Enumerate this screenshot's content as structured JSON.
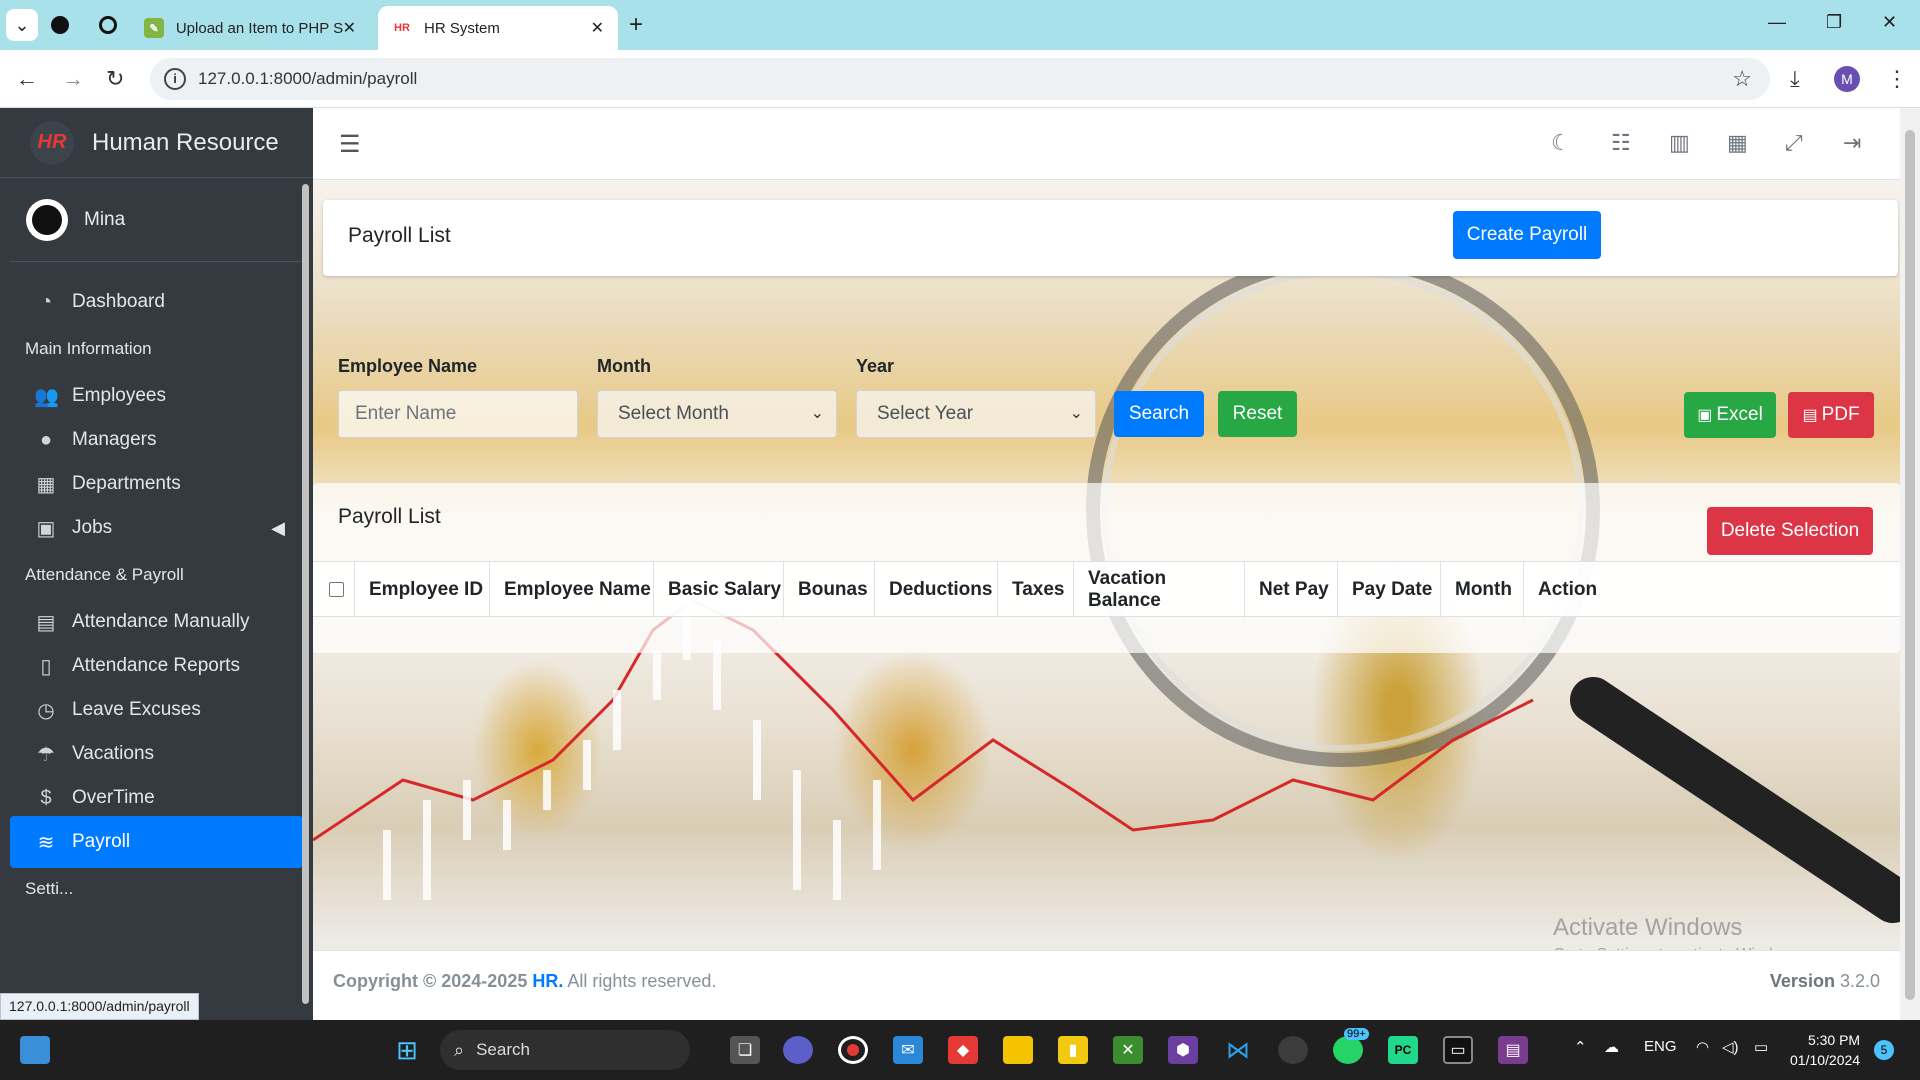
{
  "browser": {
    "tabs": [
      {
        "title": "Upload an Item to PHP Scripts | ",
        "active": false
      },
      {
        "title": "HR System",
        "active": true
      }
    ],
    "url": "127.0.0.1:8000/admin/payroll",
    "profile_initial": "M"
  },
  "sidebar": {
    "brand": "Human Resource",
    "logo_text": "HR",
    "user": "Mina",
    "items": [
      {
        "type": "item",
        "label": "Dashboard",
        "icon": "tachometer-icon"
      },
      {
        "type": "header",
        "label": "Main Information"
      },
      {
        "type": "item",
        "label": "Employees",
        "icon": "users-icon"
      },
      {
        "type": "item",
        "label": "Managers",
        "icon": "user-icon"
      },
      {
        "type": "item",
        "label": "Departments",
        "icon": "building-icon"
      },
      {
        "type": "item",
        "label": "Jobs",
        "icon": "briefcase-icon"
      },
      {
        "type": "header",
        "label": "Attendance & Payroll"
      },
      {
        "type": "item",
        "label": "Attendance Manually",
        "icon": "calendar-icon"
      },
      {
        "type": "item",
        "label": "Attendance Reports",
        "icon": "file-icon"
      },
      {
        "type": "item",
        "label": "Leave Excuses",
        "icon": "clock-icon"
      },
      {
        "type": "item",
        "label": "Vacations",
        "icon": "umbrella-beach-icon"
      },
      {
        "type": "item",
        "label": "OverTime",
        "icon": "dollar-icon"
      },
      {
        "type": "item",
        "label": "Payroll",
        "icon": "coins-icon",
        "active": true
      },
      {
        "type": "header",
        "label": "Setti..."
      }
    ],
    "status_url": "127.0.0.1:8000/admin/payroll"
  },
  "page": {
    "title": "Payroll List",
    "create_button": "Create Payroll",
    "filters": {
      "employee_name_label": "Employee Name",
      "employee_name_placeholder": "Enter Name",
      "month_label": "Month",
      "month_value": "Select Month",
      "year_label": "Year",
      "year_value": "Select Year",
      "search_button": "Search",
      "reset_button": "Reset",
      "excel_button": "Excel",
      "pdf_button": "PDF"
    },
    "list": {
      "title": "Payroll List",
      "delete_button": "Delete Selection",
      "columns": [
        "Employee ID",
        "Employee Name",
        "Basic Salary",
        "Bounas",
        "Deductions",
        "Taxes",
        "Vacation Balance",
        "Net Pay",
        "Pay Date",
        "Month",
        "Action"
      ],
      "rows": []
    }
  },
  "footer": {
    "copyright_prefix": "Copyright © 2024-2025 ",
    "brand": "HR.",
    "rights": " All rights reserved.",
    "version_label": "Version",
    "version": "3.2.0"
  },
  "watermark": {
    "line1": "Activate Windows",
    "line2": "Go to Settings to activate Windows."
  },
  "taskbar": {
    "search_placeholder": "Search",
    "language": "ENG",
    "time": "5:30 PM",
    "date": "01/10/2024",
    "notifications": "5",
    "whatsapp_badge": "99+"
  },
  "colors": {
    "primary": "#007bff",
    "success": "#28a745",
    "danger": "#dc3545",
    "sidebar_bg": "#343a40"
  }
}
